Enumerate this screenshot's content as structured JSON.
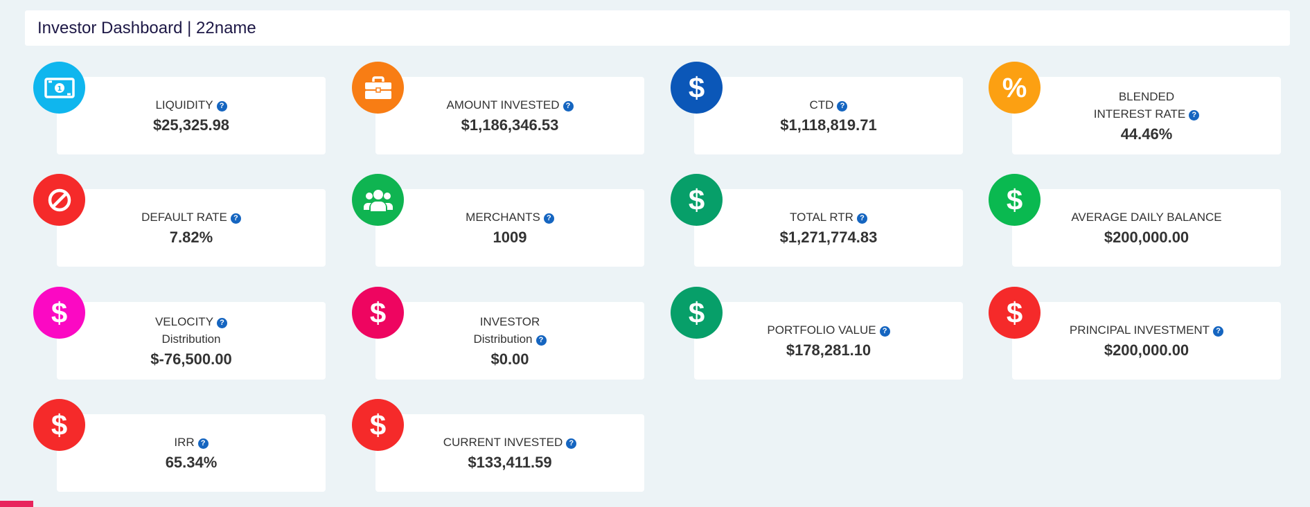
{
  "header": {
    "title": "Investor Dashboard | 22name"
  },
  "help_glyph": "?",
  "cards": [
    {
      "name": "liquidity",
      "label": "LIQUIDITY",
      "value": "$25,325.98",
      "icon": "money-bill-icon",
      "color": "#0fb6ee"
    },
    {
      "name": "amount-invested",
      "label": "AMOUNT INVESTED",
      "value": "$1,186,346.53",
      "icon": "briefcase-icon",
      "color": "#f87d14"
    },
    {
      "name": "ctd",
      "label": "CTD",
      "value": "$1,118,819.71",
      "icon": "dollar-icon",
      "color": "#0b57b8"
    },
    {
      "name": "blended-interest-rate",
      "label_line1": "BLENDED",
      "label": "INTEREST RATE",
      "value": "44.46%",
      "icon": "percent-icon",
      "color": "#fca012"
    },
    {
      "name": "default-rate",
      "label": "DEFAULT RATE",
      "value": "7.82%",
      "icon": "ban-icon",
      "color": "#f52a2a"
    },
    {
      "name": "merchants",
      "label": "MERCHANTS",
      "value": "1009",
      "icon": "users-icon",
      "color": "#0fb451"
    },
    {
      "name": "total-rtr",
      "label": "TOTAL RTR",
      "value": "$1,271,774.83",
      "icon": "dollar-icon",
      "color": "#079f69"
    },
    {
      "name": "average-daily-balance",
      "label": "AVERAGE DAILY BALANCE",
      "value": "$200,000.00",
      "icon": "dollar-icon",
      "color": "#0ab950"
    },
    {
      "name": "velocity-distribution",
      "label": "VELOCITY",
      "label_line2": "Distribution",
      "value": "$-76,500.00",
      "icon": "dollar-icon",
      "color": "#fb09c3"
    },
    {
      "name": "investor-distribution",
      "label_line1": "INVESTOR",
      "label": "Distribution",
      "value": "$0.00",
      "icon": "dollar-icon",
      "color": "#ee0560"
    },
    {
      "name": "portfolio-value",
      "label": "PORTFOLIO VALUE",
      "value": "$178,281.10",
      "icon": "dollar-icon",
      "color": "#079f69"
    },
    {
      "name": "principal-investment",
      "label": "PRINCIPAL INVESTMENT",
      "value": "$200,000.00",
      "icon": "dollar-icon",
      "color": "#f52a2a"
    },
    {
      "name": "irr",
      "label": "IRR",
      "value": "65.34%",
      "icon": "dollar-icon",
      "color": "#f52a2a"
    },
    {
      "name": "current-invested",
      "label": "CURRENT INVESTED",
      "value": "$133,411.59",
      "icon": "dollar-icon",
      "color": "#f52a2a"
    }
  ]
}
